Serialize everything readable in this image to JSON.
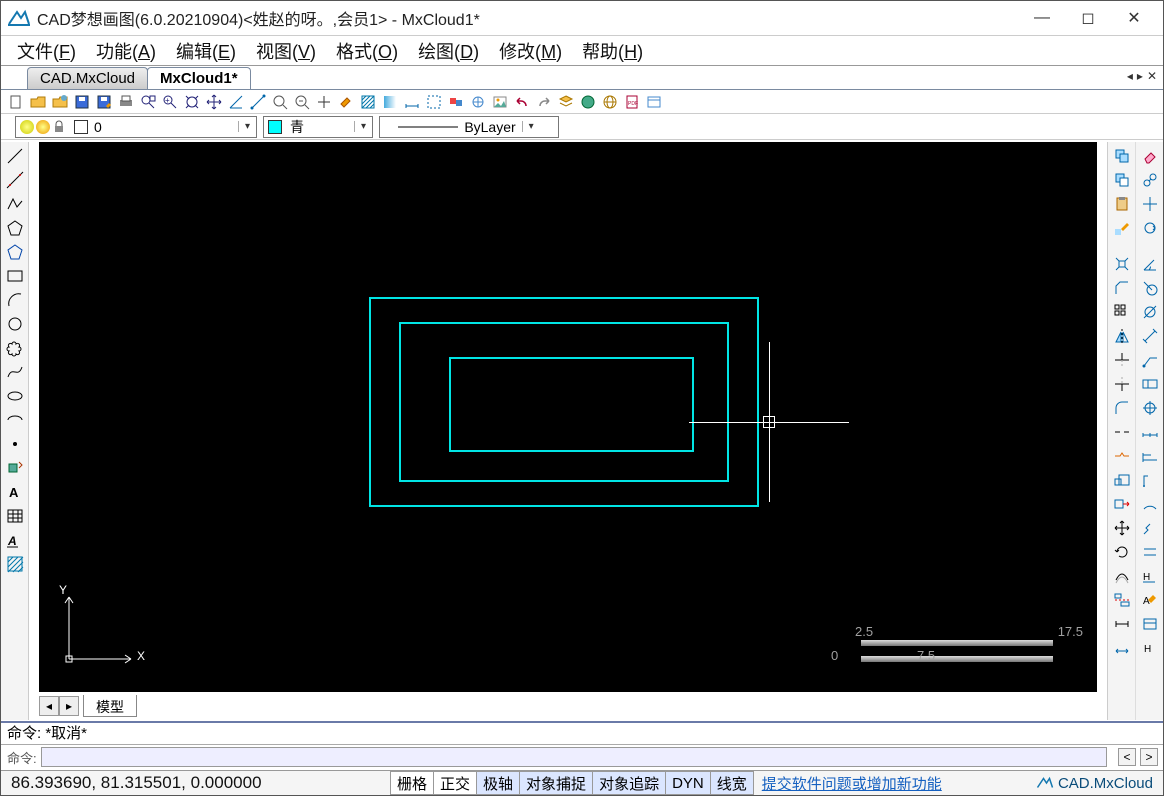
{
  "window": {
    "title": "CAD梦想画图(6.0.20210904)<姓赵的呀。,会员1> - MxCloud1*"
  },
  "menu": {
    "file": "文件(",
    "file_key": "F",
    "file_end": ")",
    "func": "功能(",
    "func_key": "A",
    "func_end": ")",
    "edit": "编辑(",
    "edit_key": "E",
    "edit_end": ")",
    "view": "视图(",
    "view_key": "V",
    "view_end": ")",
    "format": "格式(",
    "format_key": "O",
    "format_end": ")",
    "draw": "绘图(",
    "draw_key": "D",
    "draw_end": ")",
    "modify": "修改(",
    "modify_key": "M",
    "modify_end": ")",
    "help": "帮助(",
    "help_key": "H",
    "help_end": ")"
  },
  "tabs": {
    "t1": "CAD.MxCloud",
    "t2": "MxCloud1*"
  },
  "props": {
    "layer_index": "0",
    "color_name": "青",
    "linetype": "ByLayer"
  },
  "modeltab": {
    "label": "模型"
  },
  "command": {
    "history": "命令:   *取消*",
    "prompt": "命令:"
  },
  "status": {
    "coords": "86.393690, 81.315501, 0.000000",
    "grid": "栅格",
    "ortho": "正交",
    "polar": "极轴",
    "osnap": "对象捕捉",
    "otrack": "对象追踪",
    "dyn": "DYN",
    "lwt": "线宽",
    "link": "提交软件问题或增加新功能",
    "brand": "CAD.MxCloud"
  },
  "ruler": {
    "t1": "2.5",
    "t2": "17.5",
    "b1": "0",
    "b2": "7.5"
  },
  "ucs": {
    "x": "X",
    "y": "Y"
  }
}
